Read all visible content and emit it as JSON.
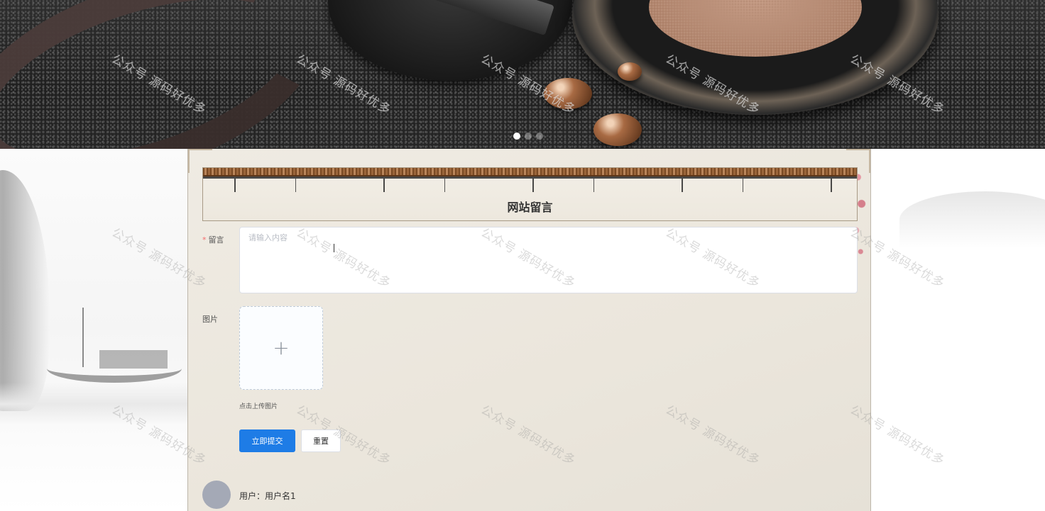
{
  "carousel": {
    "slide_count": 3,
    "active_index": 0
  },
  "form": {
    "title": "网站留言",
    "message": {
      "label": "留言",
      "required_mark": "*",
      "placeholder": "请输入内容",
      "value": ""
    },
    "image": {
      "label": "图片",
      "upload_icon": "+",
      "tip": "点击上传图片"
    },
    "buttons": {
      "submit": "立即提交",
      "reset": "重置"
    }
  },
  "comments": [
    {
      "user_line": "用户：用户名1"
    }
  ],
  "watermark": "公众号 源码好优多",
  "colors": {
    "primary": "#1e7ce6",
    "required": "#f56c6c",
    "panel_bg": "#ebe6dc"
  }
}
